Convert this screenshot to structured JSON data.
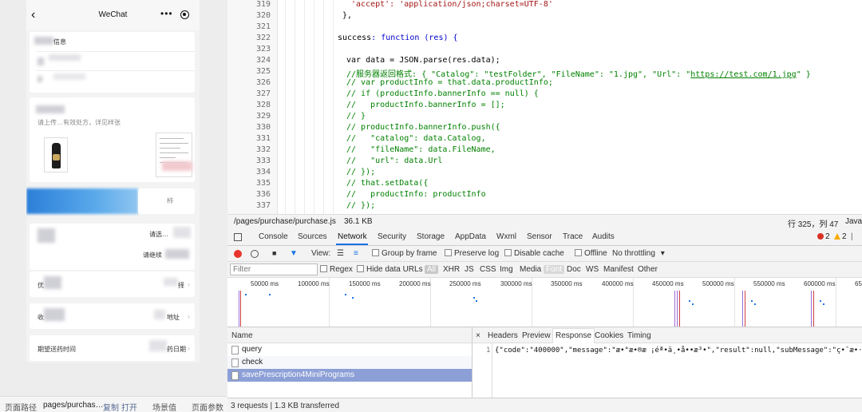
{
  "simulator": {
    "nav": {
      "back_icon": "‹",
      "title": "WeChat",
      "more_icon": "•••",
      "target_icon": "◎"
    },
    "card1": {
      "title": "信息"
    },
    "card2": {
      "hint": "请上传…有效处方，详见样张"
    },
    "row_select": "请选…",
    "row_continue": "请继续",
    "row_coupon_label": "优",
    "row_coupon_value": "择",
    "row_address_label": "收",
    "row_address_value": "地址",
    "row_date_label": "期望送药时间",
    "row_date_value": "药日期",
    "row_store_hint": "柿"
  },
  "sim_footer": {
    "path_label": "页面路径",
    "path_value": "pages/purchas…",
    "copy": "复制",
    "open": "打开",
    "scene": "场景值",
    "params": "页面参数"
  },
  "editor": {
    "lines": [
      "319",
      "320",
      "321",
      "322",
      "323",
      "324",
      "325",
      "326",
      "327",
      "328",
      "329",
      "330",
      "331",
      "332",
      "333",
      "334",
      "335",
      "336",
      "337"
    ],
    "code": {
      "l319": "'accept': 'application/json;charset=UTF-8'",
      "l320": "},",
      "l322_kw": "success",
      "l322_rest": ": function (res) {",
      "l324": "var data = JSON.parse(res.data);",
      "l325_a": "//服务器返回格式: { \"Catalog\": \"testFolder\", \"FileName\": \"1.jpg\", \"Url\": \"",
      "l325_link": "https://test.com/1.jpg",
      "l325_b": "\" }",
      "l326": "// var productInfo = that.data.productInfo;",
      "l327": "// if (productInfo.bannerInfo == null) {",
      "l328": "//   productInfo.bannerInfo = [];",
      "l329": "// }",
      "l330": "// productInfo.bannerInfo.push({",
      "l331": "//   \"catalog\": data.Catalog,",
      "l332": "//   \"fileName\": data.FileName,",
      "l333": "//   \"url\": data.Url",
      "l334": "// });",
      "l335": "// that.setData({",
      "l336": "//   productInfo: productInfo",
      "l337": "// });"
    }
  },
  "status": {
    "file": "/pages/purchase/purchase.js",
    "size": "36.1 KB",
    "position": "行 325，列 47",
    "lang": "Java"
  },
  "devtools": {
    "tabs": [
      "Console",
      "Sources",
      "Network",
      "Security",
      "Storage",
      "AppData",
      "Wxml",
      "Sensor",
      "Trace",
      "Audits"
    ],
    "active_tab": "Network",
    "errors": "2",
    "warnings": "2"
  },
  "netbar": {
    "view": "View:",
    "group": "Group by frame",
    "preserve": "Preserve log",
    "disable_cache": "Disable cache",
    "offline": "Offline",
    "throttle": "No throttling"
  },
  "filterbar": {
    "placeholder": "Filter",
    "regex": "Regex",
    "hide_urls": "Hide data URLs",
    "types": [
      "All",
      "XHR",
      "JS",
      "CSS",
      "Img",
      "Media",
      "Font",
      "Doc",
      "WS",
      "Manifest",
      "Other"
    ],
    "selected": "Font"
  },
  "timeline": {
    "ticks": [
      "50000 ms",
      "100000 ms",
      "150000 ms",
      "200000 ms",
      "250000 ms",
      "300000 ms",
      "350000 ms",
      "400000 ms",
      "450000 ms",
      "500000 ms",
      "550000 ms",
      "600000 ms",
      "650"
    ]
  },
  "requests": {
    "header": "Name",
    "items": [
      "query",
      "check",
      "savePrescription4MiniPrograms"
    ],
    "selected_index": 2,
    "summary": "3 requests | 1.3 KB transferred"
  },
  "detail": {
    "close_icon": "×",
    "tabs": [
      "Headers",
      "Preview",
      "Response",
      "Cookies",
      "Timing"
    ],
    "active_tab": "Response",
    "line_no": "1",
    "response": "{\"code\":\"400000\",\"message\":\"æ•°æ•®æ ¡éª•ä¸•å••æ³•\",\"result\":null,\"subMessage\":\"ç•¯æ•·ç±»å•"
  }
}
